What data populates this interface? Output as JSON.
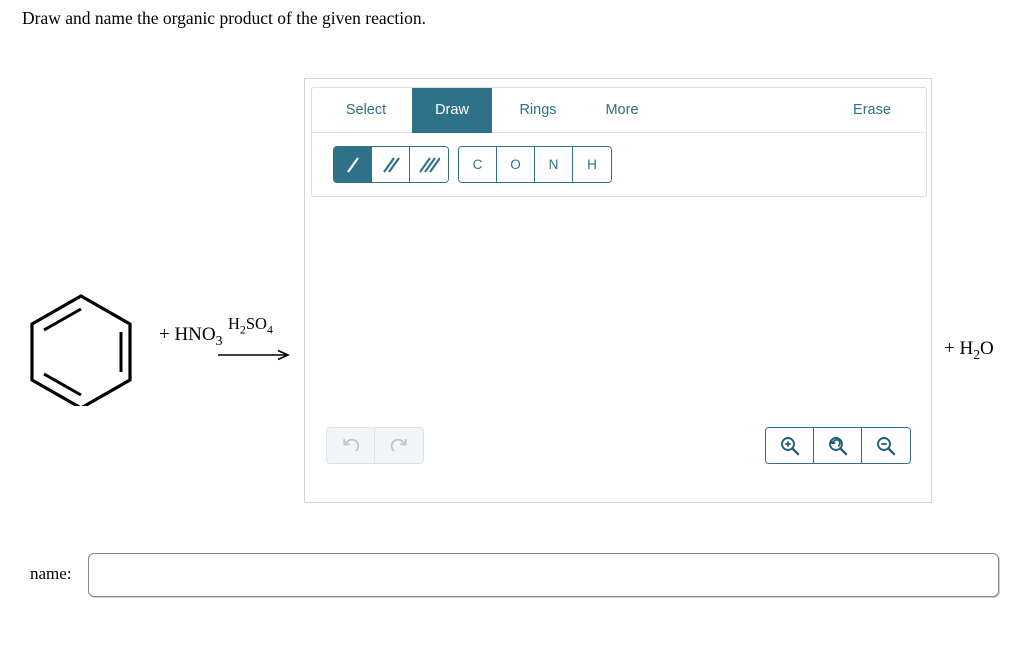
{
  "prompt": "Draw and name the organic product of the given reaction.",
  "editor": {
    "tabs": [
      {
        "id": "select",
        "label": "Select",
        "active": false
      },
      {
        "id": "draw",
        "label": "Draw",
        "active": true
      },
      {
        "id": "rings",
        "label": "Rings",
        "active": false
      },
      {
        "id": "more",
        "label": "More",
        "active": false
      }
    ],
    "erase_label": "Erase",
    "bond_tools": [
      {
        "id": "single-bond",
        "icon": "single-bond-icon",
        "active": true
      },
      {
        "id": "double-bond",
        "icon": "double-bond-icon",
        "active": false
      },
      {
        "id": "triple-bond",
        "icon": "triple-bond-icon",
        "active": false
      }
    ],
    "element_tools": [
      {
        "id": "carbon",
        "label": "C"
      },
      {
        "id": "oxygen",
        "label": "O"
      },
      {
        "id": "nitrogen",
        "label": "N"
      },
      {
        "id": "hydrogen",
        "label": "H"
      }
    ],
    "history_tools": [
      {
        "id": "undo",
        "icon": "undo-icon",
        "enabled": false
      },
      {
        "id": "redo",
        "icon": "redo-icon",
        "enabled": false
      }
    ],
    "zoom_tools": [
      {
        "id": "zoom-in",
        "icon": "zoom-in-icon"
      },
      {
        "id": "zoom-reset",
        "icon": "zoom-reset-icon"
      },
      {
        "id": "zoom-out",
        "icon": "zoom-out-icon"
      }
    ],
    "canvas_content": ""
  },
  "reaction": {
    "reactant_structure": "benzene",
    "coreagent": "+ HNO",
    "coreagent_sub": "3",
    "reagent_above_arrow": "H",
    "reagent_sub_1": "2",
    "reagent_mid": "SO",
    "reagent_sub_2": "4",
    "arrow": "reaction-arrow",
    "product_prefix": "+ H",
    "product_sub": "2",
    "product_suffix": "O"
  },
  "answer": {
    "name_label": "name:",
    "name_value": "",
    "name_placeholder": ""
  },
  "colors": {
    "accent": "#2e7189",
    "accent_dark": "#1f5f77",
    "disabled": "#b7c6cd",
    "border_gray": "#d5d5d5"
  }
}
